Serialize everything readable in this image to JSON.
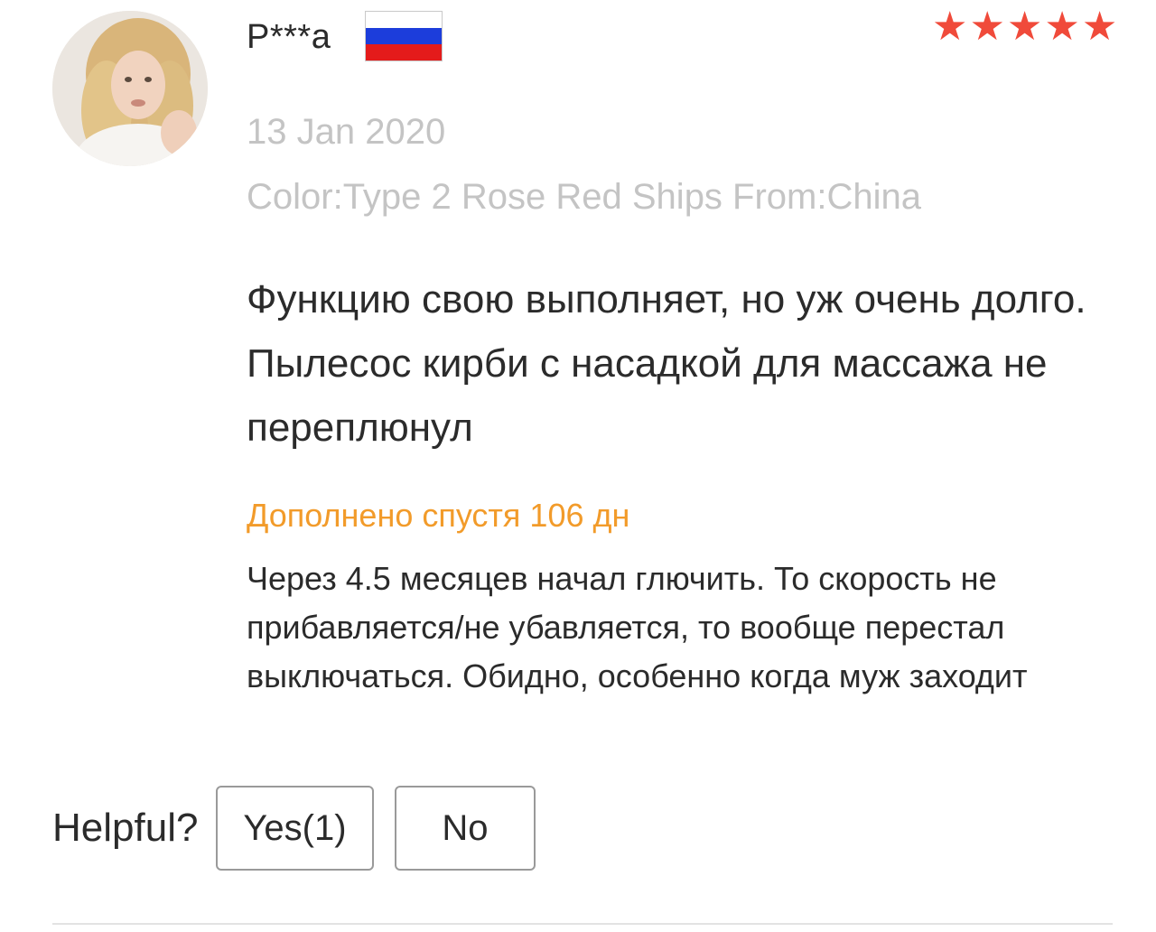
{
  "review": {
    "author": "P***a",
    "country_flag_icon": "russia-flag-icon",
    "flag_colors": [
      "#ffffff",
      "#1c3ddb",
      "#e41b1b"
    ],
    "rating": 5,
    "star_icon": "star-icon",
    "star_color": "#f04a3a",
    "date": "13 Jan 2020",
    "variant": "Color:Type 2 Rose Red Ships From:China",
    "text": "Функцию свою выполняет, но уж очень долго. Пылесос кирби с насадкой для массажа не переплюнул",
    "followup": {
      "title": "Дополнено спустя 106 дн",
      "title_color": "#f29b2a",
      "text": "Через 4.5 месяцев начал глючить. То скорость не прибавляется/не убавляется, то вообще перестал выключаться. Обидно, особенно когда муж заходит"
    }
  },
  "helpful": {
    "label": "Helpful?",
    "yes_label": "Yes(1)",
    "no_label": "No"
  }
}
